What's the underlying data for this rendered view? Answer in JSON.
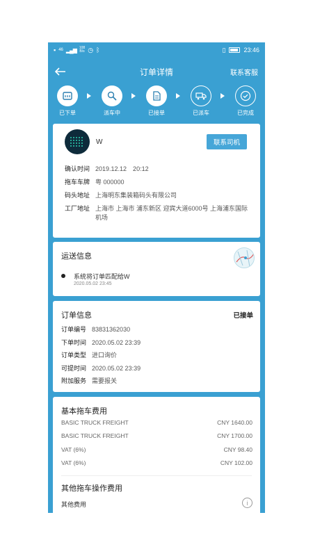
{
  "status_bar": {
    "network": "46",
    "speed_top": "108",
    "speed_bottom": "B/s",
    "time": "23:46"
  },
  "navbar": {
    "title": "订单详情",
    "contact_service": "联系客服"
  },
  "progress": {
    "steps": [
      {
        "label": "已下单",
        "icon": "receipt-icon",
        "done": true
      },
      {
        "label": "派车中",
        "icon": "search-icon",
        "done": true
      },
      {
        "label": "已接单",
        "icon": "document-icon",
        "done": true
      },
      {
        "label": "已派车",
        "icon": "truck-icon",
        "done": false
      },
      {
        "label": "已完成",
        "icon": "check-icon",
        "done": false
      }
    ]
  },
  "driver_card": {
    "driver_name": "W",
    "contact_driver": "联系司机",
    "fields": [
      {
        "key": "确认时间",
        "value": "2019.12.12　20:12"
      },
      {
        "key": "拖车车牌",
        "value": "粤 000000"
      },
      {
        "key": "码头地址",
        "value": "上海明东集装箱码头有限公司"
      },
      {
        "key": "工厂地址",
        "value": "上海市 上海市 浦东新区 迎宾大道6000号 上海浦东国际机场"
      }
    ]
  },
  "shipping_card": {
    "title": "运送信息",
    "event_text": "系统将订单匹配给W",
    "event_time": "2020.05.02 23:45"
  },
  "order_card": {
    "title": "订单信息",
    "status": "已接单",
    "fields": [
      {
        "key": "订单编号",
        "value": "83831362030"
      },
      {
        "key": "下单时间",
        "value": "2020.05.02 23:39"
      },
      {
        "key": "订单类型",
        "value": "进口询价"
      },
      {
        "key": "可提时间",
        "value": "2020.05.02 23:39"
      },
      {
        "key": "附加服务",
        "value": "需要报关"
      }
    ]
  },
  "fee_card": {
    "basic_title": "基本拖车费用",
    "basic_fees": [
      {
        "name": "BASIC TRUCK FREIGHT",
        "amount": "CNY 1640.00"
      },
      {
        "name": "BASIC TRUCK FREIGHT",
        "amount": "CNY 1700.00"
      },
      {
        "name": "VAT (6%)",
        "amount": "CNY 98.40"
      },
      {
        "name": "VAT (6%)",
        "amount": "CNY 102.00"
      }
    ],
    "other_title": "其他拖车操作费用",
    "other_fee_label": "其他费用"
  },
  "colors": {
    "primary": "#3aa0d2",
    "button": "#46a6d8",
    "avatar": "#0e2b3b",
    "avatar_dots": "#2bd1b2"
  }
}
